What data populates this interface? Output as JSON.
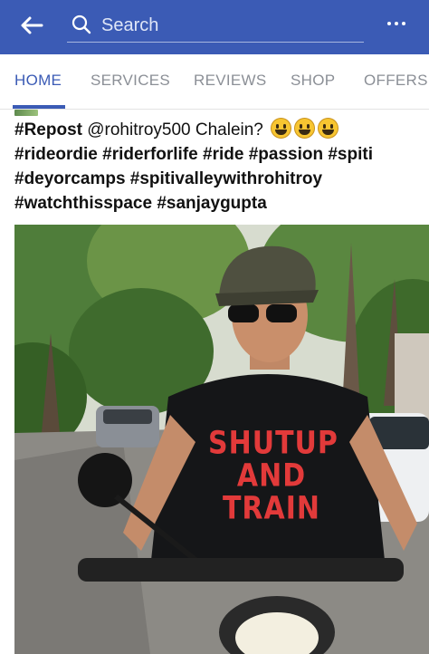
{
  "header": {
    "search_placeholder": "Search",
    "accent_color": "#3b5bb5"
  },
  "tabs": [
    {
      "label": "HOME",
      "active": true
    },
    {
      "label": "SERVICES",
      "active": false
    },
    {
      "label": "REVIEWS",
      "active": false
    },
    {
      "label": "SHOP",
      "active": false
    },
    {
      "label": "OFFERS",
      "active": false
    }
  ],
  "post": {
    "line1_tag": "#Repost",
    "line1_text": "@rohitroy500 Chalein?",
    "emoji_name": "grinning-face-emoji",
    "line2": "#rideordie #riderforlife #ride #passion #spiti",
    "line3": "#deyorcamps #spitivalleywithrohitroy",
    "line4": "#watchthisspace #sanjaygupta",
    "shirt_line1": "SHUTUP",
    "shirt_line2": "AND",
    "shirt_line3": "TRAIN"
  }
}
